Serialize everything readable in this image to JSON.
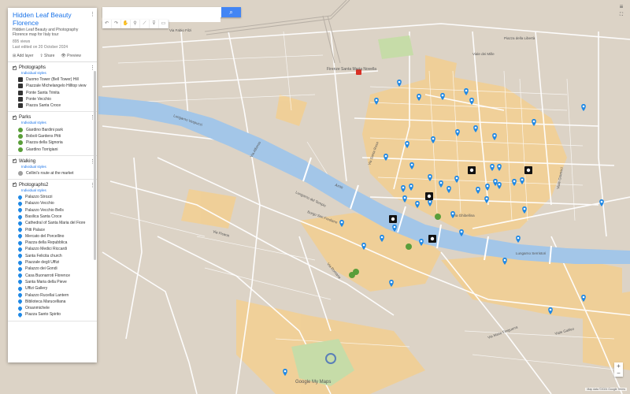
{
  "map": {
    "labels": {
      "station": "Firenze Santa Maria Novella",
      "arno": "Arno",
      "lungarno_vespucci": "Lungarno Vespucci",
      "lungarno_cascine": "Lungarno del Tempio",
      "via_sp": "Via Alfonso",
      "via_maso": "Via Maso Finiguerra",
      "via_colletta": "Via Ghibellina",
      "via_santarosa": "Via Santa Rosa",
      "via_pisana": "Via Pisana",
      "via_romana": "Via Romana",
      "viale_fratelli": "Viale dei Mille",
      "piazza_liberta": "Piazza della Libertà",
      "lungarno_serristori": "Lungarno Serristori",
      "via_gramsci": "Viale Gramsci",
      "via_sanfrediano": "Borgo San Frediano",
      "viale_gal": "Viale Galileo",
      "via_filzi": "Via Fabio Filzi"
    }
  },
  "panel": {
    "title": "Hidden Leaf Beauty Florence",
    "subtitle": "Hidden Leaf Beauty and Photography Florence map for Italy tour",
    "views": "895 views",
    "published": "Last edited on 20 October 2024",
    "actions": {
      "add": "Add layer",
      "share": "Share",
      "preview": "Preview"
    },
    "layers": [
      {
        "title": "Photographs",
        "style": "Individual styles",
        "items": [
          {
            "icon": "camera-icon",
            "label": "Duomo Tower (Bell Tower) Hill"
          },
          {
            "icon": "camera-icon",
            "label": "Piazzale Michelangelo Hilltop view"
          },
          {
            "icon": "camera-icon",
            "label": "Ponte Santa Trinita"
          },
          {
            "icon": "camera-icon",
            "label": "Ponte Vecchio"
          },
          {
            "icon": "camera-icon",
            "label": "Piazza Santa Croce"
          }
        ]
      },
      {
        "title": "Parks",
        "style": "Individual styles",
        "items": [
          {
            "icon": "park-icon",
            "label": "Giardino Bardini park"
          },
          {
            "icon": "park-icon",
            "label": "Boboli Gardens Pitti"
          },
          {
            "icon": "park-icon",
            "label": "Piazza della Signoria"
          },
          {
            "icon": "park-icon",
            "label": "Giardino Torrigiani"
          }
        ]
      },
      {
        "title": "Walking",
        "style": "Individual styles",
        "items": [
          {
            "icon": "dot-icon",
            "label": "Cellini's route at the market"
          }
        ]
      },
      {
        "title": "Photographs2",
        "style": "Individual styles",
        "items": [
          {
            "icon": "pin-icon",
            "label": "Palazzo Strozzi"
          },
          {
            "icon": "pin-icon",
            "label": "Palazzo Vecchio"
          },
          {
            "icon": "pin-icon",
            "label": "Palazzo Vecchio Bells"
          },
          {
            "icon": "pin-icon",
            "label": "Basilica Santa Croce"
          },
          {
            "icon": "pin-icon",
            "label": "Cathedral of Santa Maria del Fiore"
          },
          {
            "icon": "pin-icon",
            "label": "Pitti Palace"
          },
          {
            "icon": "pin-icon",
            "label": "Mercato del Porcellino"
          },
          {
            "icon": "pin-icon",
            "label": "Piazza della Repubblica"
          },
          {
            "icon": "pin-icon",
            "label": "Palazzo Medici Riccardi"
          },
          {
            "icon": "pin-icon",
            "label": "Santa Felicita church"
          },
          {
            "icon": "pin-icon",
            "label": "Piazzale degli Uffizi"
          },
          {
            "icon": "pin-icon",
            "label": "Palazzo dei Gondi"
          },
          {
            "icon": "pin-icon",
            "label": "Casa Buonarroti Florence"
          },
          {
            "icon": "pin-icon",
            "label": "Santa Maria della Pieve"
          },
          {
            "icon": "pin-icon",
            "label": "Uffizi Gallery"
          },
          {
            "icon": "pin-icon",
            "label": "Palazzo Rucellai Lantern"
          },
          {
            "icon": "pin-icon",
            "label": "Biblioteca Marucelliana"
          },
          {
            "icon": "pin-icon",
            "label": "Orsanmichele"
          },
          {
            "icon": "pin-icon",
            "label": "Piazza Santo Spirito"
          }
        ]
      }
    ]
  },
  "search": {
    "placeholder": "",
    "button_icon": "search-icon"
  },
  "toolbar": {
    "icons": [
      "undo-icon",
      "redo-icon",
      "hand-icon",
      "marker-icon",
      "line-icon",
      "filter-icon",
      "ruler-icon"
    ]
  },
  "attribution": "Map data ©2024 Google  Terms",
  "logo": "Google My Maps",
  "colors": {
    "water": "#a3c6e8",
    "land": "#dcd3c6",
    "highlight": "#f2cf94",
    "road": "#ffffff",
    "pin": "#1e88e5",
    "park": "#5a9e3a"
  }
}
